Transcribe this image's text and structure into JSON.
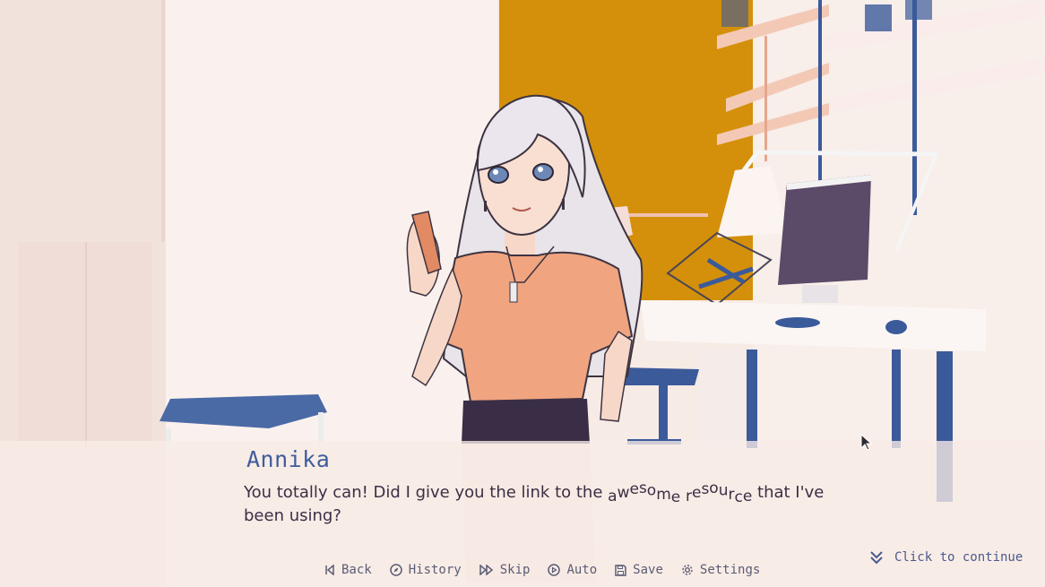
{
  "dialog": {
    "speaker": "Annika",
    "line_before": "You totally can! Did I give you the link to the ",
    "wavy_word_1": "awesome",
    "space": " ",
    "wavy_word_2": "resource",
    "line_after": " that I've been using?"
  },
  "continue_prompt": {
    "label": "Click to continue",
    "icon": "double-chevron-down-icon"
  },
  "quick_menu": {
    "items": [
      {
        "label": "Back",
        "icon": "back-icon"
      },
      {
        "label": "History",
        "icon": "compass-icon"
      },
      {
        "label": "Skip",
        "icon": "fast-forward-icon"
      },
      {
        "label": "Auto",
        "icon": "play-circle-icon"
      },
      {
        "label": "Save",
        "icon": "floppy-disk-icon"
      },
      {
        "label": "Settings",
        "icon": "gear-icon"
      }
    ]
  },
  "colors": {
    "name_color": "#3f5d9c",
    "text_color": "#3b2f45",
    "wall_orange": "#d4900a",
    "accent_blue": "#3b5a9a",
    "background": "#f6e8e2"
  }
}
